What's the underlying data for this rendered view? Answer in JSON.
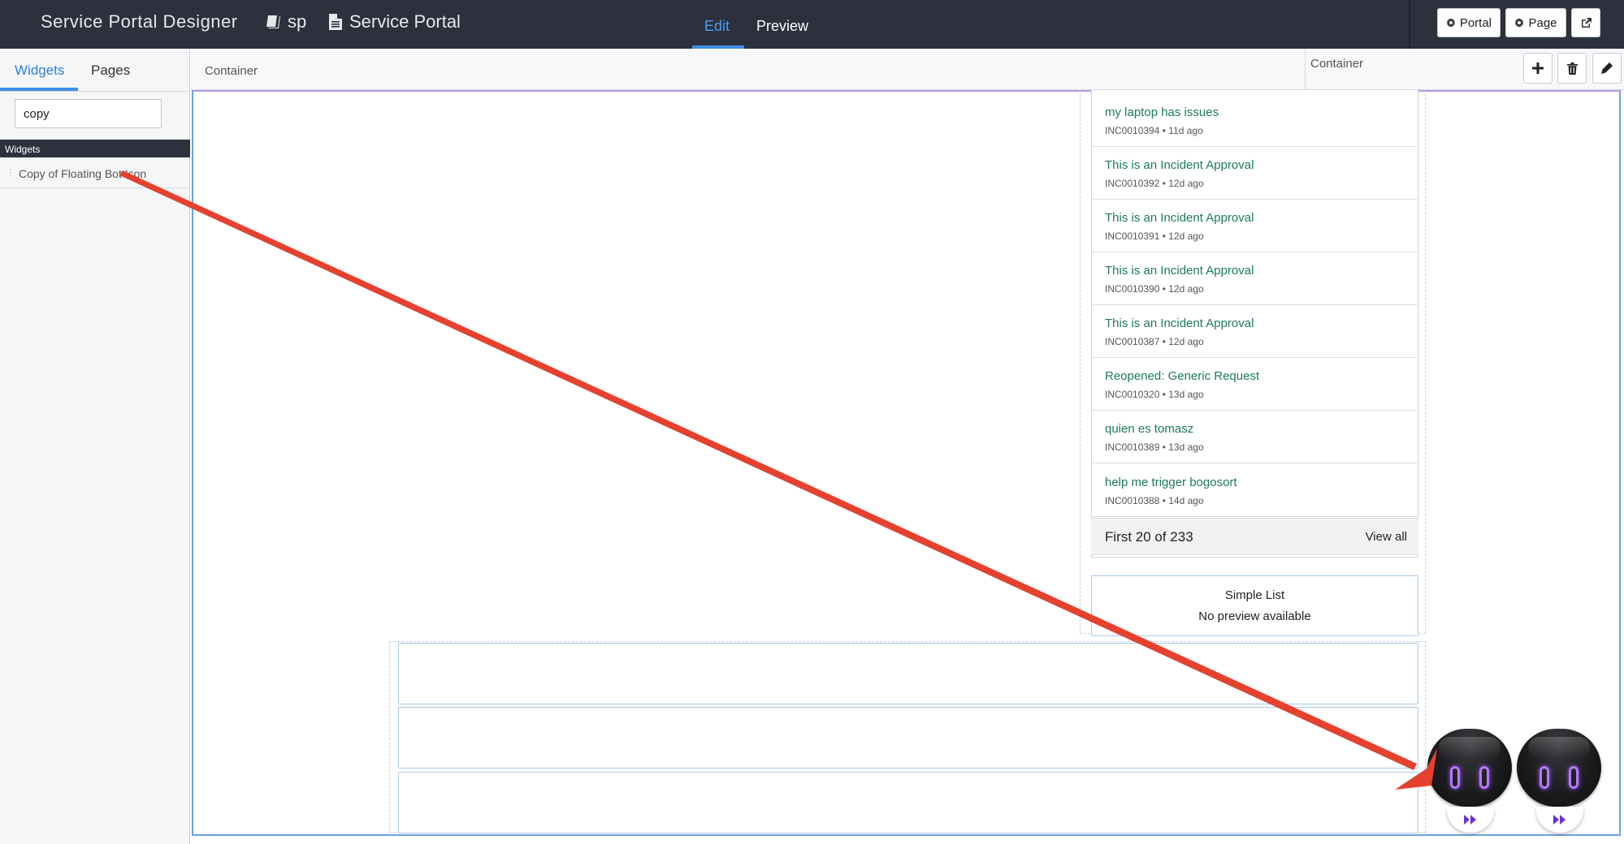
{
  "topbar": {
    "app_title": "Service Portal Designer",
    "crumb_book": "sp",
    "crumb_doc": "Service Portal",
    "mode_edit": "Edit",
    "mode_preview": "Preview",
    "btn_portal": "Portal",
    "btn_page": "Page"
  },
  "left_panel": {
    "tab_widgets": "Widgets",
    "tab_pages": "Pages",
    "search_value": "copy",
    "section_title": "Widgets",
    "items": [
      {
        "label": "Copy of Floating Bot Icon"
      }
    ]
  },
  "canvas": {
    "header_label": "Container",
    "props_label": "Container"
  },
  "list_widget": {
    "items": [
      {
        "title": "my laptop has issues",
        "meta": "INC0010394 • 11d ago"
      },
      {
        "title": "This is an Incident Approval",
        "meta": "INC0010392 • 12d ago"
      },
      {
        "title": "This is an Incident Approval",
        "meta": "INC0010391 • 12d ago"
      },
      {
        "title": "This is an Incident Approval",
        "meta": "INC0010390 • 12d ago"
      },
      {
        "title": "This is an Incident Approval",
        "meta": "INC0010387 • 12d ago"
      },
      {
        "title": "Reopened: Generic Request",
        "meta": "INC0010320 • 13d ago"
      },
      {
        "title": "quien es tomasz",
        "meta": "INC0010389 • 13d ago"
      },
      {
        "title": "help me trigger bogosort",
        "meta": "INC0010388 • 14d ago"
      }
    ],
    "footer_count": "First 20 of 233",
    "footer_view_all": "View all"
  },
  "simple_list": {
    "title": "Simple List",
    "subtitle": "No preview available"
  },
  "colors": {
    "topbar_bg": "#2c313d",
    "accent_blue": "#3d8fe5",
    "link_green": "#1d7a5f",
    "annotation_arrow": "#e5412f",
    "bot_eye": "#b777ff"
  },
  "icons": [
    "book-icon",
    "document-icon",
    "gear-icon",
    "external-link-icon",
    "plus-icon",
    "trash-icon",
    "pencil-icon",
    "fast-forward-icon"
  ]
}
